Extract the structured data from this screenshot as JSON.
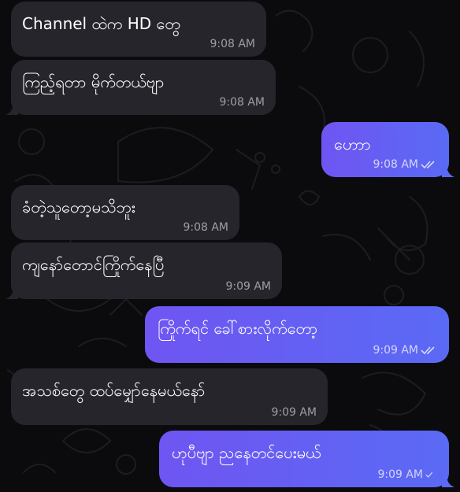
{
  "messages": [
    {
      "direction": "in",
      "text": "Channel ထဲက HD တွေ",
      "time": "9:08 AM"
    },
    {
      "direction": "in",
      "text": "ကြည့်ရတာ မိုက်တယ်ဗျာ",
      "time": "9:08 AM"
    },
    {
      "direction": "out",
      "text": "ဟောာ",
      "time": "9:08 AM",
      "status_icon": "double-check-icon"
    },
    {
      "direction": "in",
      "text": "ခံတဲ့သူတော့မသိဘူး",
      "time": "9:08 AM"
    },
    {
      "direction": "in",
      "text": "ကျနော်တောင်ကြိုက်နေပြီ",
      "time": "9:09 AM"
    },
    {
      "direction": "out",
      "text": "ကြိုက်ရင် ခေါ်စားလိုက်တော့",
      "time": "9:09 AM",
      "status_icon": "double-check-icon"
    },
    {
      "direction": "in",
      "text": "အသစ်တွေ ထပ်မျှော်နေမယ်နော်",
      "time": "9:09 AM"
    },
    {
      "direction": "out",
      "text": "ဟုပီဗျာ ညနေတင်ပေးမယ်",
      "time": "9:09 AM",
      "status_icon": "single-check-icon"
    }
  ],
  "colors": {
    "background": "#0b0b0d",
    "incoming_bubble": "#27252c",
    "outgoing_gradient_start": "#6f55f2",
    "outgoing_gradient_end": "#5a6af4",
    "doodle": "#1c1b22"
  }
}
